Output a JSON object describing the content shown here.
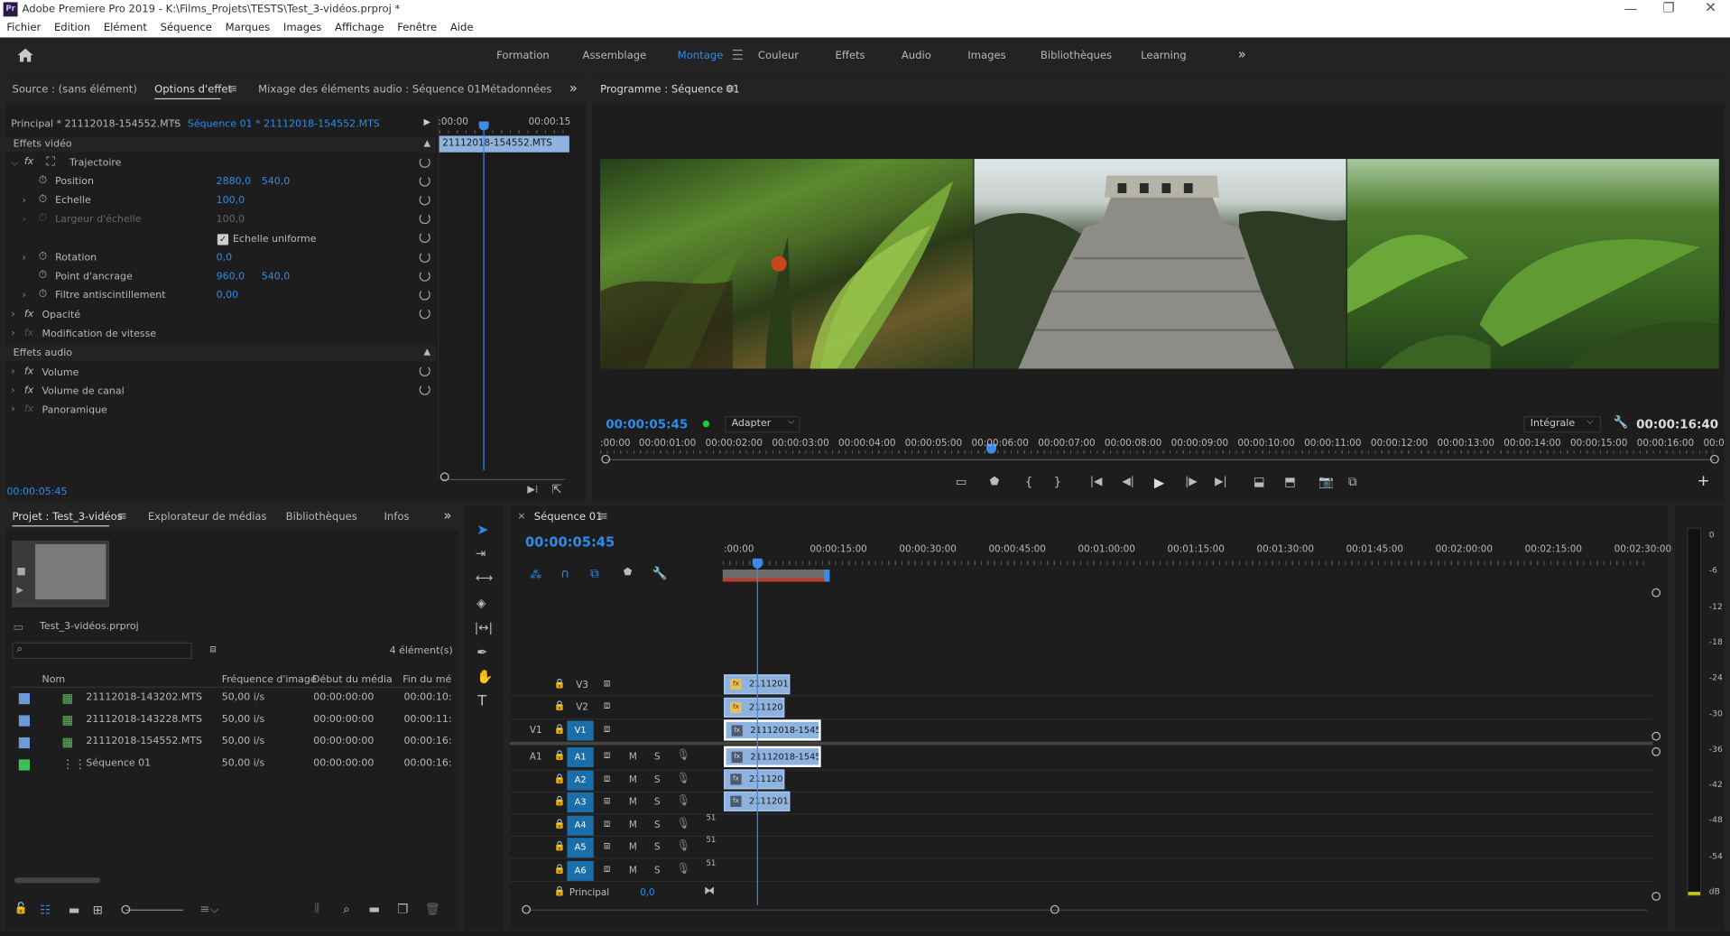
{
  "window": {
    "title": "Adobe Premiere Pro 2019 - K:\\Films_Projets\\TESTS\\Test_3-vidéos.prproj *",
    "app_badge": "Pr"
  },
  "menu": [
    "Fichier",
    "Edition",
    "Elément",
    "Séquence",
    "Marques",
    "Images",
    "Affichage",
    "Fenêtre",
    "Aide"
  ],
  "workspaces": [
    "Formation",
    "Assemblage",
    "Montage",
    "Couleur",
    "Effets",
    "Audio",
    "Images",
    "Bibliothèques",
    "Learning"
  ],
  "workspaces_active": "Montage",
  "effect_panel": {
    "tabs": [
      "Source : (sans élément)",
      "Options d'effet",
      "Mixage des éléments audio : Séquence 01",
      "Métadonnées"
    ],
    "master_label": "Principal * 21112018-154552.MTS",
    "seq_label": "Séquence 01 * 21112018-154552.MTS",
    "ruler_start": ":00:00",
    "ruler_end": "00:00:15",
    "clip_name": "21112018-154552.MTS",
    "section_video": "Effets vidéo",
    "section_audio": "Effets audio",
    "fx_trajectoire": "Trajectoire",
    "params": {
      "position": {
        "label": "Position",
        "v1": "2880,0",
        "v2": "540,0"
      },
      "echelle": {
        "label": "Echelle",
        "v1": "100,0"
      },
      "largeur": {
        "label": "Largeur d'échelle",
        "v1": "100,0"
      },
      "uniforme": "Echelle uniforme",
      "rotation": {
        "label": "Rotation",
        "v1": "0,0"
      },
      "ancrage": {
        "label": "Point d'ancrage",
        "v1": "960,0",
        "v2": "540,0"
      },
      "filtre": {
        "label": "Filtre antiscintillement",
        "v1": "0,00"
      }
    },
    "fx_opacite": "Opacité",
    "fx_vitesse": "Modification de vitesse",
    "fx_volume": "Volume",
    "fx_volcanal": "Volume de canal",
    "fx_pano": "Panoramique",
    "timecode": "00:00:05:45"
  },
  "program": {
    "title": "Programme : Séquence 01",
    "timecode": "00:00:05:45",
    "fit": "Adapter",
    "quality": "Intégrale",
    "duration": "00:00:16:40",
    "ruler": ":00:00",
    "ruler_labels": [
      "00:00:01:00",
      "00:00:02:00",
      "00:00:03:00",
      "00:00:04:00",
      "00:00:05:00",
      "00:00:06:00",
      "00:00:07:00",
      "00:00:08:00",
      "00:00:09:00",
      "00:00:10:00",
      "00:00:11:00",
      "00:00:12:00",
      "00:00:13:00",
      "00:00:14:00",
      "00:00:15:00",
      "00:00:16:00",
      "00:0"
    ]
  },
  "project": {
    "tabs": [
      "Projet : Test_3-vidéos",
      "Explorateur de médias",
      "Bibliothèques",
      "Infos"
    ],
    "file": "Test_3-vidéos.prproj",
    "count": "4 élément(s)",
    "columns": [
      "Nom",
      "Fréquence d'image",
      "Début du média",
      "Fin du mé"
    ],
    "items": [
      {
        "name": "21112018-143202.MTS",
        "fps": "50,00 i/s",
        "start": "00:00:00:00",
        "end": "00:00:10:",
        "color": "#6a9bd8"
      },
      {
        "name": "21112018-143228.MTS",
        "fps": "50,00 i/s",
        "start": "00:00:00:00",
        "end": "00:00:11:",
        "color": "#6a9bd8"
      },
      {
        "name": "21112018-154552.MTS",
        "fps": "50,00 i/s",
        "start": "00:00:00:00",
        "end": "00:00:16:",
        "color": "#6a9bd8"
      },
      {
        "name": "Séquence 01",
        "fps": "50,00 i/s",
        "start": "00:00:00:00",
        "end": "00:00:16:",
        "color": "#3fbf5a"
      }
    ]
  },
  "timeline": {
    "title": "Séquence 01",
    "timecode": "00:00:05:45",
    "ruler": [
      ":00:00",
      "00:00:15:00",
      "00:00:30:00",
      "00:00:45:00",
      "00:01:00:00",
      "00:01:15:00",
      "00:01:30:00",
      "00:01:45:00",
      "00:02:00:00",
      "00:02:15:00",
      "00:02:30:00"
    ],
    "video_tracks": [
      "V3",
      "V2",
      "V1"
    ],
    "audio_tracks": [
      "A1",
      "A2",
      "A3",
      "A4",
      "A5",
      "A6"
    ],
    "src_v": "V1",
    "src_a": "A1",
    "m": "M",
    "s": "S",
    "master": "Principal",
    "master_val": "0,0",
    "clip_v3": "21112018-",
    "clip_v2": "2111201",
    "clip_v1": "21112018-154552",
    "clip_a1": "21112018-154552",
    "clip_a2": "2111201",
    "clip_a3": "21112018-",
    "tag_51": "51"
  },
  "meter_labels": [
    "0",
    "-6",
    "-12",
    "-18",
    "-24",
    "-30",
    "-36",
    "-42",
    "-48",
    "-54",
    "dB"
  ]
}
